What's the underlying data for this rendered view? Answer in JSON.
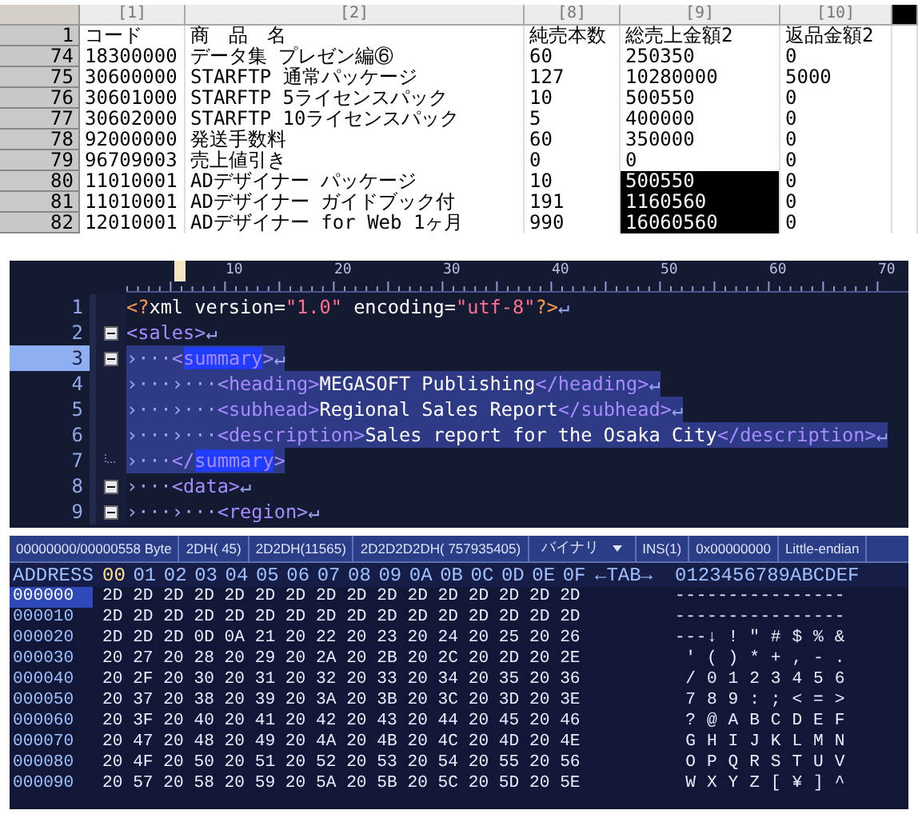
{
  "spreadsheet": {
    "columns": [
      {
        "label": "[1]",
        "selected": false
      },
      {
        "label": "[2]",
        "selected": false
      },
      {
        "label": "[8]",
        "selected": false
      },
      {
        "label": "[9]",
        "selected": false
      },
      {
        "label": "[10]",
        "selected": false
      },
      {
        "selected": true
      }
    ],
    "rows": [
      {
        "num": "1",
        "code": "コード",
        "name": "商　品　名",
        "qty": "純売本数",
        "gross": "総売上金額2",
        "returns": "返品金額2",
        "gross_selected": false
      },
      {
        "num": "74",
        "code": "18300000",
        "name": "データ集 プレゼン編⑥",
        "qty": "60",
        "gross": "250350",
        "returns": "0",
        "gross_selected": false
      },
      {
        "num": "75",
        "code": "30600000",
        "name": "STARFTP 通常パッケージ",
        "qty": "127",
        "gross": "10280000",
        "returns": "5000",
        "gross_selected": false
      },
      {
        "num": "76",
        "code": "30601000",
        "name": "STARFTP 5ライセンスパック",
        "qty": "10",
        "gross": "500550",
        "returns": "0",
        "gross_selected": false
      },
      {
        "num": "77",
        "code": "30602000",
        "name": "STARFTP 10ライセンスパック",
        "qty": "5",
        "gross": "400000",
        "returns": "0",
        "gross_selected": false
      },
      {
        "num": "78",
        "code": "92000000",
        "name": "発送手数料",
        "qty": "60",
        "gross": "350000",
        "returns": "0",
        "gross_selected": false
      },
      {
        "num": "79",
        "code": "96709003",
        "name": "売上値引き",
        "qty": "0",
        "gross": "0",
        "returns": "0",
        "gross_selected": false
      },
      {
        "num": "80",
        "code": "11010001",
        "name": "ADデザイナー パッケージ",
        "qty": "10",
        "gross": "500550",
        "returns": "0",
        "gross_selected": true
      },
      {
        "num": "81",
        "code": "11010001",
        "name": "ADデザイナー ガイドブック付",
        "qty": "191",
        "gross": "1160560",
        "returns": "0",
        "gross_selected": true
      },
      {
        "num": "82",
        "code": "12010001",
        "name": "ADデザイナー for Web 1ヶ月",
        "qty": "990",
        "gross": "16060560",
        "returns": "0",
        "gross_selected": true
      }
    ]
  },
  "xml_editor": {
    "ruler": [
      "10",
      "20",
      "30",
      "40",
      "50",
      "60",
      "70"
    ],
    "lines": [
      {
        "num": "1",
        "collapsible": false,
        "fold_end": false,
        "current": false,
        "selected": false,
        "tokens": [
          {
            "kind": "pi",
            "text": "<?"
          },
          {
            "kind": "plain",
            "text": "xml version="
          },
          {
            "kind": "string",
            "text": "\"1.0\""
          },
          {
            "kind": "plain",
            "text": " encoding="
          },
          {
            "kind": "string",
            "text": "\"utf-8\""
          },
          {
            "kind": "pi",
            "text": "?>"
          },
          {
            "kind": "eol",
            "text": "↵"
          }
        ]
      },
      {
        "num": "2",
        "collapsible": true,
        "fold_end": false,
        "current": false,
        "selected": false,
        "tokens": [
          {
            "kind": "tag",
            "text": "<sales>"
          },
          {
            "kind": "eol",
            "text": "↵"
          }
        ]
      },
      {
        "num": "3",
        "collapsible": true,
        "fold_end": false,
        "current": true,
        "selected": true,
        "tokens": [
          {
            "kind": "tab",
            "text": "›···"
          },
          {
            "kind": "tag",
            "text": "<"
          },
          {
            "kind": "match",
            "text": "summary"
          },
          {
            "kind": "tag",
            "text": ">"
          },
          {
            "kind": "eol",
            "text": "↵"
          }
        ]
      },
      {
        "num": "4",
        "collapsible": false,
        "fold_end": false,
        "current": false,
        "selected": true,
        "tokens": [
          {
            "kind": "tab",
            "text": "›···"
          },
          {
            "kind": "tab",
            "text": "›···"
          },
          {
            "kind": "tag",
            "text": "<heading>"
          },
          {
            "kind": "plain",
            "text": "MEGASOFT Publishing"
          },
          {
            "kind": "tag",
            "text": "</heading>"
          },
          {
            "kind": "eol",
            "text": "↵"
          }
        ]
      },
      {
        "num": "5",
        "collapsible": false,
        "fold_end": false,
        "current": false,
        "selected": true,
        "tokens": [
          {
            "kind": "tab",
            "text": "›···"
          },
          {
            "kind": "tab",
            "text": "›···"
          },
          {
            "kind": "tag",
            "text": "<subhead>"
          },
          {
            "kind": "plain",
            "text": "Regional Sales Report"
          },
          {
            "kind": "tag",
            "text": "</subhead>"
          },
          {
            "kind": "eol",
            "text": "↵"
          }
        ]
      },
      {
        "num": "6",
        "collapsible": false,
        "fold_end": false,
        "current": false,
        "selected": true,
        "tokens": [
          {
            "kind": "tab",
            "text": "›···"
          },
          {
            "kind": "tab",
            "text": "›···"
          },
          {
            "kind": "tag",
            "text": "<description>"
          },
          {
            "kind": "plain",
            "text": "Sales report for the Osaka City"
          },
          {
            "kind": "tag",
            "text": "</description>"
          },
          {
            "kind": "eol",
            "text": "↵"
          }
        ]
      },
      {
        "num": "7",
        "collapsible": false,
        "fold_end": true,
        "current": false,
        "selected": true,
        "tokens": [
          {
            "kind": "tab",
            "text": "›···"
          },
          {
            "kind": "tag",
            "text": "</"
          },
          {
            "kind": "match",
            "text": "summary"
          },
          {
            "kind": "tag",
            "text": ">"
          }
        ]
      },
      {
        "num": "8",
        "collapsible": true,
        "fold_end": false,
        "current": false,
        "selected": false,
        "tokens": [
          {
            "kind": "tab",
            "text": "›···"
          },
          {
            "kind": "tag",
            "text": "<data>"
          },
          {
            "kind": "eol",
            "text": "↵"
          }
        ]
      },
      {
        "num": "9",
        "collapsible": true,
        "fold_end": false,
        "current": false,
        "selected": false,
        "tokens": [
          {
            "kind": "tab",
            "text": "›···"
          },
          {
            "kind": "tab",
            "text": "›···"
          },
          {
            "kind": "tag",
            "text": "<region>"
          },
          {
            "kind": "eol",
            "text": "↵"
          }
        ]
      }
    ]
  },
  "hex_editor": {
    "status_bar": [
      {
        "kind": "text",
        "text": "00000000/00000558 Byte"
      },
      {
        "kind": "text",
        "text": "2DH( 45)"
      },
      {
        "kind": "text",
        "text": "2D2DH(11565)"
      },
      {
        "kind": "text",
        "text": "2D2D2D2DH( 757935405)"
      },
      {
        "kind": "dropdown",
        "text": "バイナリ"
      },
      {
        "kind": "text",
        "text": "INS(1)"
      },
      {
        "kind": "text",
        "text": "0x00000000"
      },
      {
        "kind": "text",
        "text": "Little-endian"
      }
    ],
    "header": {
      "address": "ADDRESS",
      "columns": [
        {
          "label": "00",
          "selected": true
        },
        {
          "label": "01",
          "selected": false
        },
        {
          "label": "02",
          "selected": false
        },
        {
          "label": "03",
          "selected": false
        },
        {
          "label": "04",
          "selected": false
        },
        {
          "label": "05",
          "selected": false
        },
        {
          "label": "06",
          "selected": false
        },
        {
          "label": "07",
          "selected": false
        },
        {
          "label": "08",
          "selected": false
        },
        {
          "label": "09",
          "selected": false
        },
        {
          "label": "0A",
          "selected": false
        },
        {
          "label": "0B",
          "selected": false
        },
        {
          "label": "0C",
          "selected": false
        },
        {
          "label": "0D",
          "selected": false
        },
        {
          "label": "0E",
          "selected": false
        },
        {
          "label": "0F",
          "selected": false
        }
      ],
      "tab": "←TAB→",
      "text": "0123456789ABCDEF"
    },
    "rows": [
      {
        "address": "000000",
        "selected": true,
        "bytes": "2D 2D 2D 2D 2D 2D 2D 2D 2D 2D 2D 2D 2D 2D 2D 2D",
        "text": "----------------"
      },
      {
        "address": "000010",
        "selected": false,
        "bytes": "2D 2D 2D 2D 2D 2D 2D 2D 2D 2D 2D 2D 2D 2D 2D 2D",
        "text": "----------------"
      },
      {
        "address": "000020",
        "selected": false,
        "bytes": "2D 2D 2D 0D 0A 21 20 22 20 23 20 24 20 25 20 26",
        "text": "---↓ ! ″ # $ % &"
      },
      {
        "address": "000030",
        "selected": false,
        "bytes": "20 27 20 28 20 29 20 2A 20 2B 20 2C 20 2D 20 2E",
        "text": " ' ( ) * + , - ."
      },
      {
        "address": "000040",
        "selected": false,
        "bytes": "20 2F 20 30 20 31 20 32 20 33 20 34 20 35 20 36",
        "text": " / 0 1 2 3 4 5 6"
      },
      {
        "address": "000050",
        "selected": false,
        "bytes": "20 37 20 38 20 39 20 3A 20 3B 20 3C 20 3D 20 3E",
        "text": " 7 8 9 : ; < = >"
      },
      {
        "address": "000060",
        "selected": false,
        "bytes": "20 3F 20 40 20 41 20 42 20 43 20 44 20 45 20 46",
        "text": " ? @ A B C D E F"
      },
      {
        "address": "000070",
        "selected": false,
        "bytes": "20 47 20 48 20 49 20 4A 20 4B 20 4C 20 4D 20 4E",
        "text": " G H I J K L M N"
      },
      {
        "address": "000080",
        "selected": false,
        "bytes": "20 4F 20 50 20 51 20 52 20 53 20 54 20 55 20 56",
        "text": " O P Q R S T U V"
      },
      {
        "address": "000090",
        "selected": false,
        "bytes": "20 57 20 58 20 59 20 5A 20 5B 20 5C 20 5D 20 5E",
        "text": " W X Y Z [ ¥ ] ^"
      }
    ]
  }
}
